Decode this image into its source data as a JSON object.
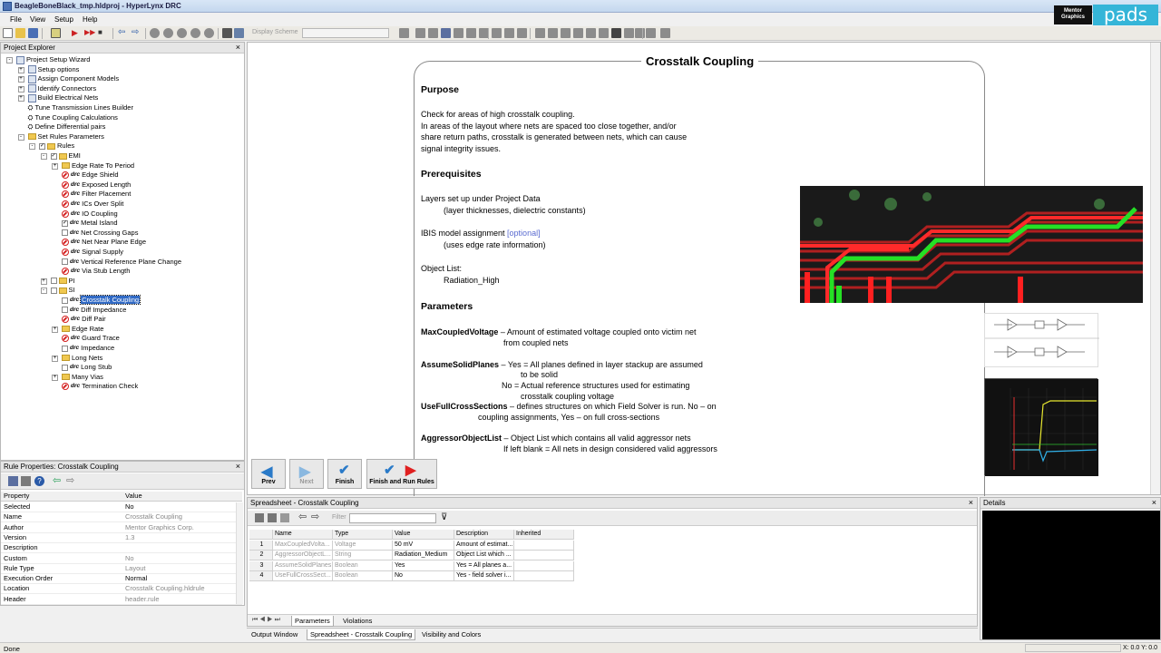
{
  "window": {
    "title": "BeagleBoneBlack_tmp.hldproj - HyperLynx DRC"
  },
  "menu": [
    "File",
    "View",
    "Setup",
    "Help"
  ],
  "toolbar": {
    "display_scheme_label": "Display Scheme"
  },
  "brand": {
    "badge": "Mentor Graphics",
    "product": "pads"
  },
  "explorer": {
    "title": "Project Explorer",
    "rows": [
      {
        "label": "Project Setup Wizard",
        "type": "wizard",
        "indent": 0,
        "exp": "-"
      },
      {
        "label": "Setup options",
        "type": "wizard",
        "indent": 1,
        "exp": "+"
      },
      {
        "label": "Assign Component Models",
        "type": "wizard",
        "indent": 1,
        "exp": "+"
      },
      {
        "label": "Identify Connectors",
        "type": "wizard",
        "indent": 1,
        "exp": "+"
      },
      {
        "label": "Build Electrical Nets",
        "type": "wizard",
        "indent": 1,
        "exp": "+"
      },
      {
        "label": "Tune Transmission Lines Builder",
        "type": "tool",
        "indent": 1,
        "exp": ""
      },
      {
        "label": "Tune Coupling Calculations",
        "type": "tool",
        "indent": 1,
        "exp": ""
      },
      {
        "label": "Define Differential pairs",
        "type": "tool",
        "indent": 1,
        "exp": ""
      },
      {
        "label": "Set Rules Parameters",
        "type": "folder",
        "indent": 1,
        "exp": "-"
      },
      {
        "label": "Rules",
        "type": "checkfolder",
        "indent": 2,
        "exp": "-"
      },
      {
        "label": "EMI",
        "type": "checkfolder",
        "indent": 3,
        "exp": "-"
      },
      {
        "label": "Edge Rate To Period",
        "type": "folder",
        "indent": 4,
        "exp": "+"
      },
      {
        "label": "Edge Shield",
        "type": "nodrc",
        "indent": 4,
        "exp": ""
      },
      {
        "label": "Exposed Length",
        "type": "nodrc",
        "indent": 4,
        "exp": ""
      },
      {
        "label": "Filter Placement",
        "type": "nodrc",
        "indent": 4,
        "exp": ""
      },
      {
        "label": "ICs Over Split",
        "type": "nodrc",
        "indent": 4,
        "exp": ""
      },
      {
        "label": "IO Coupling",
        "type": "nodrc",
        "indent": 4,
        "exp": ""
      },
      {
        "label": "Metal Island",
        "type": "checkdrc",
        "indent": 4,
        "exp": ""
      },
      {
        "label": "Net Crossing Gaps",
        "type": "boxdrc",
        "indent": 4,
        "exp": ""
      },
      {
        "label": "Net Near Plane Edge",
        "type": "nodrc",
        "indent": 4,
        "exp": ""
      },
      {
        "label": "Signal Supply",
        "type": "nodrc",
        "indent": 4,
        "exp": ""
      },
      {
        "label": "Vertical Reference Plane Change",
        "type": "boxdrc",
        "indent": 4,
        "exp": ""
      },
      {
        "label": "Via Stub Length",
        "type": "nodrc",
        "indent": 4,
        "exp": ""
      },
      {
        "label": "PI",
        "type": "boxfolder",
        "indent": 3,
        "exp": "+"
      },
      {
        "label": "SI",
        "type": "boxfolder",
        "indent": 3,
        "exp": "-"
      },
      {
        "label": "Crosstalk Coupling",
        "type": "boxdrc",
        "indent": 4,
        "exp": "",
        "selected": true
      },
      {
        "label": "Diff Impedance",
        "type": "boxdrc",
        "indent": 4,
        "exp": ""
      },
      {
        "label": "Diff Pair",
        "type": "nodrc",
        "indent": 4,
        "exp": ""
      },
      {
        "label": "Edge Rate",
        "type": "folder",
        "indent": 4,
        "exp": "+"
      },
      {
        "label": "Guard Trace",
        "type": "nodrc",
        "indent": 4,
        "exp": ""
      },
      {
        "label": "Impedance",
        "type": "boxdrc",
        "indent": 4,
        "exp": ""
      },
      {
        "label": "Long Nets",
        "type": "folder",
        "indent": 4,
        "exp": "+"
      },
      {
        "label": "Long Stub",
        "type": "boxdrc",
        "indent": 4,
        "exp": ""
      },
      {
        "label": "Many Vias",
        "type": "folder",
        "indent": 4,
        "exp": "+"
      },
      {
        "label": "Termination Check",
        "type": "nodrc",
        "indent": 4,
        "exp": ""
      }
    ]
  },
  "props": {
    "title": "Rule Properties: Crosstalk Coupling",
    "col_property": "Property",
    "col_value": "Value",
    "rows": [
      {
        "k": "Selected",
        "v": "No",
        "dark": true
      },
      {
        "k": "Name",
        "v": "Crosstalk Coupling"
      },
      {
        "k": "Author",
        "v": "Mentor Graphics Corp."
      },
      {
        "k": "Version",
        "v": "1.3"
      },
      {
        "k": "Description",
        "v": ""
      },
      {
        "k": "Custom",
        "v": "No"
      },
      {
        "k": "Rule Type",
        "v": "Layout"
      },
      {
        "k": "Execution Order",
        "v": "Normal",
        "dark": true
      },
      {
        "k": "Location",
        "v": "Crosstalk Coupling.hldrule"
      },
      {
        "k": "Header",
        "v": "header.rule"
      }
    ]
  },
  "doc": {
    "title": "Crosstalk Coupling",
    "purpose_h": "Purpose",
    "purpose_1": "Check for areas of high crosstalk coupling.",
    "purpose_2": "In areas of the layout where nets are spaced too close together, and/or",
    "purpose_3": "share return  paths, crosstalk is generated between nets, which can cause",
    "purpose_4": "signal integrity issues.",
    "prereq_h": "Prerequisites",
    "prereq_1": "Layers set up under Project Data",
    "prereq_2": "(layer thicknesses, dielectric constants)",
    "prereq_3": "IBIS model  assignment ",
    "prereq_3_opt": "[optional]",
    "prereq_4": "(uses edge rate information)",
    "prereq_5": "Object List:",
    "prereq_6": "Radiation_High",
    "params_h": "Parameters",
    "p1_name": "MaxCoupledVoltage",
    "p1_desc": " – Amount of estimated voltage coupled onto victim net",
    "p1_desc2": "from coupled nets",
    "p2_name": "AssumeSolidPlanes",
    "p2_desc": " – Yes = All planes defined in layer stackup are assumed",
    "p2_desc2": "to be solid",
    "p2_desc3": "No =  Actual reference structures used for estimating",
    "p2_desc4": "crosstalk coupling voltage",
    "p3_name": "UseFullCrossSections",
    "p3_desc": " – defines structures on which Field Solver is run. No – on",
    "p3_desc2": "coupling  assignments, Yes – on full cross-sections",
    "p4_name": "AggressorObjectList",
    "p4_desc": " – Object List which contains all valid aggressor nets",
    "p4_desc2": "If left blank = All nets in design considered valid aggressors"
  },
  "wizard_buttons": {
    "prev": "Prev",
    "next": "Next",
    "finish": "Finish",
    "finish_run": "Finish and Run Rules"
  },
  "spreadsheet": {
    "title": "Spreadsheet - Crosstalk Coupling",
    "type_label": "Type",
    "filter_label": "Filter",
    "columns": [
      "Name",
      "Type",
      "Value",
      "Description",
      "Inherited"
    ],
    "rows": [
      [
        "1",
        "MaxCoupledVolta...",
        "Voltage",
        "50 mV",
        "Amount of estimat..."
      ],
      [
        "2",
        "AggressorObjectL...",
        "String",
        "Radiation_Medium",
        "Object List which ..."
      ],
      [
        "3",
        "AssumeSolidPlanes",
        "Boolean",
        "Yes",
        "Yes = All planes a..."
      ],
      [
        "4",
        "UseFullCrossSect...",
        "Boolean",
        "No",
        "Yes - field solver i..."
      ]
    ],
    "tabs": [
      "Parameters",
      "Violations"
    ]
  },
  "details": {
    "title": "Details"
  },
  "bottom_tabs": [
    "Output Window",
    "Spreadsheet - Crosstalk Coupling",
    "Visibility and Colors"
  ],
  "status": {
    "left": "Done",
    "coords": "X: 0.0  Y: 0.0"
  },
  "colors": {
    "accent": "#316ac5",
    "brand": "#35b5d8",
    "trace_red": "#e02020",
    "trace_green": "#20e020"
  }
}
